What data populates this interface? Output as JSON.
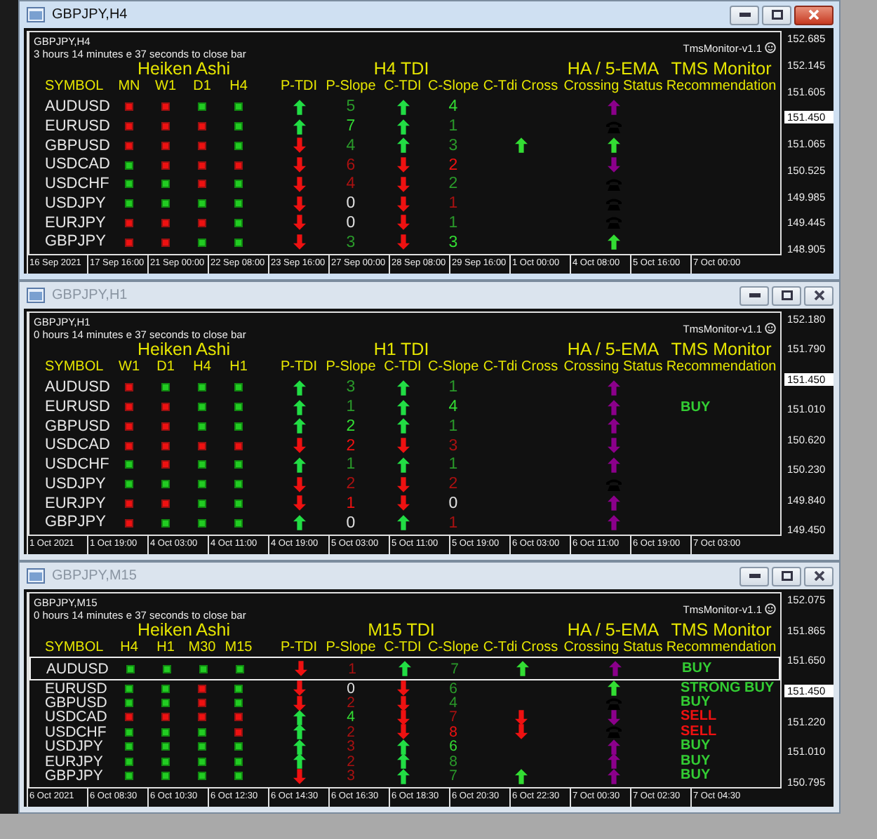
{
  "windows": [
    {
      "title": "GBPJPY,H4",
      "active": true,
      "chart_symbol": "GBPJPY,H4",
      "countdown": "3 hours 14 minutes e 37 seconds to close bar",
      "indicator": "TmsMonitor-v1.1",
      "groups": {
        "heiken": "Heiken Ashi",
        "tdi": "H4 TDI",
        "ema": "HA / 5-EMA",
        "tms": "TMS Monitor"
      },
      "columns": [
        "SYMBOL",
        "MN",
        "W1",
        "D1",
        "H4",
        "P-TDI",
        "P-Slope",
        "C-TDI",
        "C-Slope",
        "C-Tdi Cross",
        "Crossing Status",
        "Recommendation"
      ],
      "rows": [
        {
          "symbol": "AUDUSD",
          "selected": false,
          "ha": [
            {
              "bullish": false
            },
            {
              "bullish": false
            },
            {
              "bullish": true
            },
            {
              "bullish": true
            }
          ],
          "p_tdi": {
            "up": true
          },
          "p_slope": {
            "text": "5",
            "color": "#2a9a2a"
          },
          "c_tdi": {
            "up": true
          },
          "c_slope": {
            "text": "4",
            "color": "#33dd33"
          },
          "status": {
            "kind": "arrow",
            "up": true,
            "color": "#8b008b"
          }
        },
        {
          "symbol": "EURUSD",
          "selected": false,
          "ha": [
            {
              "bullish": false
            },
            {
              "bullish": false
            },
            {
              "bullish": false
            },
            {
              "bullish": true
            }
          ],
          "p_tdi": {
            "up": true
          },
          "p_slope": {
            "text": "7",
            "color": "#33dd33"
          },
          "c_tdi": {
            "up": true
          },
          "c_slope": {
            "text": "1",
            "color": "#2a9a2a"
          },
          "status": {
            "kind": "phone"
          }
        },
        {
          "symbol": "GBPUSD",
          "selected": false,
          "ha": [
            {
              "bullish": false
            },
            {
              "bullish": false
            },
            {
              "bullish": false
            },
            {
              "bullish": true
            }
          ],
          "p_tdi": {
            "up": false
          },
          "p_slope": {
            "text": "4",
            "color": "#2a9a2a"
          },
          "c_tdi": {
            "up": true
          },
          "c_slope": {
            "text": "3",
            "color": "#2a9a2a"
          },
          "cross": {
            "up": true,
            "color": "#33dd33"
          },
          "status": {
            "kind": "arrow",
            "up": true,
            "color": "#33dd33"
          }
        },
        {
          "symbol": "USDCAD",
          "selected": false,
          "ha": [
            {
              "bullish": true
            },
            {
              "bullish": false
            },
            {
              "bullish": false
            },
            {
              "bullish": false
            }
          ],
          "p_tdi": {
            "up": false
          },
          "p_slope": {
            "text": "6",
            "color": "#aa1111"
          },
          "c_tdi": {
            "up": false
          },
          "c_slope": {
            "text": "2",
            "color": "#ee1111"
          },
          "status": {
            "kind": "arrow",
            "up": false,
            "color": "#8b008b"
          }
        },
        {
          "symbol": "USDCHF",
          "selected": false,
          "ha": [
            {
              "bullish": true
            },
            {
              "bullish": true
            },
            {
              "bullish": false
            },
            {
              "bullish": true
            }
          ],
          "p_tdi": {
            "up": false
          },
          "p_slope": {
            "text": "4",
            "color": "#aa1111"
          },
          "c_tdi": {
            "up": false
          },
          "c_slope": {
            "text": "2",
            "color": "#2a9a2a"
          },
          "status": {
            "kind": "phone"
          }
        },
        {
          "symbol": "USDJPY",
          "selected": false,
          "ha": [
            {
              "bullish": true
            },
            {
              "bullish": true
            },
            {
              "bullish": true
            },
            {
              "bullish": true
            }
          ],
          "p_tdi": {
            "up": false
          },
          "p_slope": {
            "text": "0",
            "color": "#e0e0e0"
          },
          "c_tdi": {
            "up": false
          },
          "c_slope": {
            "text": "1",
            "color": "#aa1111"
          },
          "status": {
            "kind": "phone"
          }
        },
        {
          "symbol": "EURJPY",
          "selected": false,
          "ha": [
            {
              "bullish": false
            },
            {
              "bullish": false
            },
            {
              "bullish": false
            },
            {
              "bullish": true
            }
          ],
          "p_tdi": {
            "up": false
          },
          "p_slope": {
            "text": "0",
            "color": "#e0e0e0"
          },
          "c_tdi": {
            "up": false
          },
          "c_slope": {
            "text": "1",
            "color": "#2a9a2a"
          },
          "status": {
            "kind": "phone"
          }
        },
        {
          "symbol": "GBPJPY",
          "selected": false,
          "ha": [
            {
              "bullish": false
            },
            {
              "bullish": false
            },
            {
              "bullish": true
            },
            {
              "bullish": true
            }
          ],
          "p_tdi": {
            "up": false
          },
          "p_slope": {
            "text": "3",
            "color": "#2a9a2a"
          },
          "c_tdi": {
            "up": false
          },
          "c_slope": {
            "text": "3",
            "color": "#33dd33"
          },
          "status": {
            "kind": "arrow",
            "up": true,
            "color": "#33dd33"
          }
        }
      ],
      "time_axis": [
        "16 Sep 2021",
        "17 Sep 16:00",
        "21 Sep 00:00",
        "22 Sep 08:00",
        "23 Sep 16:00",
        "27 Sep 00:00",
        "28 Sep 08:00",
        "29 Sep 16:00",
        "1 Oct 00:00",
        "4 Oct 08:00",
        "5 Oct 16:00",
        "7 Oct 00:00"
      ],
      "price_axis": [
        {
          "text": "152.685",
          "current": false
        },
        {
          "text": "152.145",
          "current": false
        },
        {
          "text": "151.605",
          "current": false
        },
        {
          "text": "151.450",
          "current": true
        },
        {
          "text": "151.065",
          "current": false
        },
        {
          "text": "150.525",
          "current": false
        },
        {
          "text": "149.985",
          "current": false
        },
        {
          "text": "149.445",
          "current": false
        },
        {
          "text": "148.905",
          "current": false
        }
      ]
    },
    {
      "title": "GBPJPY,H1",
      "active": false,
      "chart_symbol": "GBPJPY,H1",
      "countdown": "0 hours 14 minutes e 37 seconds to close bar",
      "indicator": "TmsMonitor-v1.1",
      "groups": {
        "heiken": "Heiken Ashi",
        "tdi": "H1 TDI",
        "ema": "HA / 5-EMA",
        "tms": "TMS Monitor"
      },
      "columns": [
        "SYMBOL",
        "W1",
        "D1",
        "H4",
        "H1",
        "P-TDI",
        "P-Slope",
        "C-TDI",
        "C-Slope",
        "C-Tdi Cross",
        "Crossing Status",
        "Recommendation"
      ],
      "rows": [
        {
          "symbol": "AUDUSD",
          "selected": false,
          "ha": [
            {
              "bullish": false
            },
            {
              "bullish": true
            },
            {
              "bullish": true
            },
            {
              "bullish": true
            }
          ],
          "p_tdi": {
            "up": true
          },
          "p_slope": {
            "text": "3",
            "color": "#2a9a2a"
          },
          "c_tdi": {
            "up": true
          },
          "c_slope": {
            "text": "1",
            "color": "#2a9a2a"
          },
          "status": {
            "kind": "arrow",
            "up": true,
            "color": "#8b008b"
          }
        },
        {
          "symbol": "EURUSD",
          "selected": false,
          "ha": [
            {
              "bullish": false
            },
            {
              "bullish": false
            },
            {
              "bullish": true
            },
            {
              "bullish": true
            }
          ],
          "p_tdi": {
            "up": true
          },
          "p_slope": {
            "text": "1",
            "color": "#2a9a2a"
          },
          "c_tdi": {
            "up": true
          },
          "c_slope": {
            "text": "4",
            "color": "#33dd33"
          },
          "status": {
            "kind": "arrow",
            "up": true,
            "color": "#8b008b"
          },
          "recommendation": {
            "text": "BUY",
            "color": "#33cc33"
          }
        },
        {
          "symbol": "GBPUSD",
          "selected": false,
          "ha": [
            {
              "bullish": false
            },
            {
              "bullish": false
            },
            {
              "bullish": true
            },
            {
              "bullish": true
            }
          ],
          "p_tdi": {
            "up": true
          },
          "p_slope": {
            "text": "2",
            "color": "#33dd33"
          },
          "c_tdi": {
            "up": true
          },
          "c_slope": {
            "text": "1",
            "color": "#2a9a2a"
          },
          "status": {
            "kind": "arrow",
            "up": true,
            "color": "#8b008b"
          }
        },
        {
          "symbol": "USDCAD",
          "selected": false,
          "ha": [
            {
              "bullish": false
            },
            {
              "bullish": false
            },
            {
              "bullish": false
            },
            {
              "bullish": false
            }
          ],
          "p_tdi": {
            "up": false
          },
          "p_slope": {
            "text": "2",
            "color": "#ee1111"
          },
          "c_tdi": {
            "up": false
          },
          "c_slope": {
            "text": "3",
            "color": "#aa1111"
          },
          "status": {
            "kind": "arrow",
            "up": false,
            "color": "#8b008b"
          }
        },
        {
          "symbol": "USDCHF",
          "selected": false,
          "ha": [
            {
              "bullish": true
            },
            {
              "bullish": false
            },
            {
              "bullish": true
            },
            {
              "bullish": true
            }
          ],
          "p_tdi": {
            "up": true
          },
          "p_slope": {
            "text": "1",
            "color": "#2a9a2a"
          },
          "c_tdi": {
            "up": true
          },
          "c_slope": {
            "text": "1",
            "color": "#2a9a2a"
          },
          "status": {
            "kind": "arrow",
            "up": true,
            "color": "#8b008b"
          }
        },
        {
          "symbol": "USDJPY",
          "selected": false,
          "ha": [
            {
              "bullish": true
            },
            {
              "bullish": true
            },
            {
              "bullish": true
            },
            {
              "bullish": true
            }
          ],
          "p_tdi": {
            "up": false
          },
          "p_slope": {
            "text": "2",
            "color": "#aa1111"
          },
          "c_tdi": {
            "up": false
          },
          "c_slope": {
            "text": "2",
            "color": "#aa1111"
          },
          "status": {
            "kind": "phone"
          }
        },
        {
          "symbol": "EURJPY",
          "selected": false,
          "ha": [
            {
              "bullish": false
            },
            {
              "bullish": false
            },
            {
              "bullish": true
            },
            {
              "bullish": true
            }
          ],
          "p_tdi": {
            "up": false
          },
          "p_slope": {
            "text": "1",
            "color": "#ee1111"
          },
          "c_tdi": {
            "up": false
          },
          "c_slope": {
            "text": "0",
            "color": "#e0e0e0"
          },
          "status": {
            "kind": "arrow",
            "up": true,
            "color": "#8b008b"
          }
        },
        {
          "symbol": "GBPJPY",
          "selected": false,
          "ha": [
            {
              "bullish": false
            },
            {
              "bullish": true
            },
            {
              "bullish": true
            },
            {
              "bullish": true
            }
          ],
          "p_tdi": {
            "up": true
          },
          "p_slope": {
            "text": "0",
            "color": "#e0e0e0"
          },
          "c_tdi": {
            "up": true
          },
          "c_slope": {
            "text": "1",
            "color": "#aa1111"
          },
          "status": {
            "kind": "arrow",
            "up": true,
            "color": "#8b008b"
          }
        }
      ],
      "time_axis": [
        "1 Oct 2021",
        "1 Oct 19:00",
        "4 Oct 03:00",
        "4 Oct 11:00",
        "4 Oct 19:00",
        "5 Oct 03:00",
        "5 Oct 11:00",
        "5 Oct 19:00",
        "6 Oct 03:00",
        "6 Oct 11:00",
        "6 Oct 19:00",
        "7 Oct 03:00"
      ],
      "price_axis": [
        {
          "text": "152.180",
          "current": false
        },
        {
          "text": "151.790",
          "current": false
        },
        {
          "text": "151.450",
          "current": true
        },
        {
          "text": "151.010",
          "current": false
        },
        {
          "text": "150.620",
          "current": false
        },
        {
          "text": "150.230",
          "current": false
        },
        {
          "text": "149.840",
          "current": false
        },
        {
          "text": "149.450",
          "current": false
        }
      ]
    },
    {
      "title": "GBPJPY,M15",
      "active": false,
      "chart_symbol": "GBPJPY,M15",
      "countdown": "0 hours 14 minutes e 37 seconds to close bar",
      "indicator": "TmsMonitor-v1.1",
      "groups": {
        "heiken": "Heiken Ashi",
        "tdi": "M15 TDI",
        "ema": "HA / 5-EMA",
        "tms": "TMS Monitor"
      },
      "columns": [
        "SYMBOL",
        "H4",
        "H1",
        "M30",
        "M15",
        "P-TDI",
        "P-Slope",
        "C-TDI",
        "C-Slope",
        "C-Tdi Cross",
        "Crossing Status",
        "Recommendation"
      ],
      "rows": [
        {
          "symbol": "AUDUSD",
          "selected": true,
          "ha": [
            {
              "bullish": true
            },
            {
              "bullish": true
            },
            {
              "bullish": true
            },
            {
              "bullish": true
            }
          ],
          "p_tdi": {
            "up": false
          },
          "p_slope": {
            "text": "1",
            "color": "#aa1111"
          },
          "c_tdi": {
            "up": true
          },
          "c_slope": {
            "text": "7",
            "color": "#2a9a2a"
          },
          "cross": {
            "up": true,
            "color": "#33dd33"
          },
          "status": {
            "kind": "arrow",
            "up": true,
            "color": "#8b008b"
          },
          "recommendation": {
            "text": "BUY",
            "color": "#33cc33"
          }
        },
        {
          "symbol": "EURUSD",
          "selected": false,
          "ha": [
            {
              "bullish": true
            },
            {
              "bullish": true
            },
            {
              "bullish": false
            },
            {
              "bullish": true
            }
          ],
          "p_tdi": {
            "up": false
          },
          "p_slope": {
            "text": "0",
            "color": "#e0e0e0"
          },
          "c_tdi": {
            "up": false
          },
          "c_slope": {
            "text": "6",
            "color": "#2a9a2a"
          },
          "status": {
            "kind": "arrow",
            "up": true,
            "color": "#33dd33"
          },
          "recommendation": {
            "text": "STRONG BUY",
            "color": "#33cc33"
          }
        },
        {
          "symbol": "GBPUSD",
          "selected": false,
          "ha": [
            {
              "bullish": true
            },
            {
              "bullish": true
            },
            {
              "bullish": false
            },
            {
              "bullish": true
            }
          ],
          "p_tdi": {
            "up": false
          },
          "p_slope": {
            "text": "2",
            "color": "#aa1111"
          },
          "c_tdi": {
            "up": false
          },
          "c_slope": {
            "text": "4",
            "color": "#2a9a2a"
          },
          "status": {
            "kind": "phone"
          },
          "recommendation": {
            "text": "BUY",
            "color": "#33cc33"
          }
        },
        {
          "symbol": "USDCAD",
          "selected": false,
          "ha": [
            {
              "bullish": false
            },
            {
              "bullish": false
            },
            {
              "bullish": false
            },
            {
              "bullish": false
            }
          ],
          "p_tdi": {
            "up": true
          },
          "p_slope": {
            "text": "4",
            "color": "#33dd33"
          },
          "c_tdi": {
            "up": false
          },
          "c_slope": {
            "text": "7",
            "color": "#aa1111"
          },
          "cross": {
            "up": false,
            "color": "#ee1111"
          },
          "status": {
            "kind": "arrow",
            "up": false,
            "color": "#8b008b"
          },
          "recommendation": {
            "text": "SELL",
            "color": "#ee1111"
          }
        },
        {
          "symbol": "USDCHF",
          "selected": false,
          "ha": [
            {
              "bullish": true
            },
            {
              "bullish": true
            },
            {
              "bullish": true
            },
            {
              "bullish": false
            }
          ],
          "p_tdi": {
            "up": true
          },
          "p_slope": {
            "text": "2",
            "color": "#aa1111"
          },
          "c_tdi": {
            "up": false
          },
          "c_slope": {
            "text": "8",
            "color": "#ee1111"
          },
          "cross": {
            "up": false,
            "color": "#ee1111"
          },
          "status": {
            "kind": "phone"
          },
          "recommendation": {
            "text": "SELL",
            "color": "#ee1111"
          }
        },
        {
          "symbol": "USDJPY",
          "selected": false,
          "ha": [
            {
              "bullish": true
            },
            {
              "bullish": true
            },
            {
              "bullish": true
            },
            {
              "bullish": true
            }
          ],
          "p_tdi": {
            "up": true
          },
          "p_slope": {
            "text": "3",
            "color": "#aa1111"
          },
          "c_tdi": {
            "up": true
          },
          "c_slope": {
            "text": "6",
            "color": "#33dd33"
          },
          "status": {
            "kind": "arrow",
            "up": true,
            "color": "#8b008b"
          },
          "recommendation": {
            "text": "BUY",
            "color": "#33cc33"
          }
        },
        {
          "symbol": "EURJPY",
          "selected": false,
          "ha": [
            {
              "bullish": true
            },
            {
              "bullish": true
            },
            {
              "bullish": true
            },
            {
              "bullish": true
            }
          ],
          "p_tdi": {
            "up": true
          },
          "p_slope": {
            "text": "2",
            "color": "#aa1111"
          },
          "c_tdi": {
            "up": true
          },
          "c_slope": {
            "text": "8",
            "color": "#2a9a2a"
          },
          "status": {
            "kind": "arrow",
            "up": true,
            "color": "#8b008b"
          },
          "recommendation": {
            "text": "BUY",
            "color": "#33cc33"
          }
        },
        {
          "symbol": "GBPJPY",
          "selected": false,
          "ha": [
            {
              "bullish": true
            },
            {
              "bullish": true
            },
            {
              "bullish": true
            },
            {
              "bullish": true
            }
          ],
          "p_tdi": {
            "up": false
          },
          "p_slope": {
            "text": "3",
            "color": "#aa1111"
          },
          "c_tdi": {
            "up": true
          },
          "c_slope": {
            "text": "7",
            "color": "#2a9a2a"
          },
          "cross": {
            "up": true,
            "color": "#33dd33"
          },
          "status": {
            "kind": "arrow",
            "up": true,
            "color": "#8b008b"
          },
          "recommendation": {
            "text": "BUY",
            "color": "#33cc33"
          }
        }
      ],
      "time_axis": [
        "6 Oct 2021",
        "6 Oct 08:30",
        "6 Oct 10:30",
        "6 Oct 12:30",
        "6 Oct 14:30",
        "6 Oct 16:30",
        "6 Oct 18:30",
        "6 Oct 20:30",
        "6 Oct 22:30",
        "7 Oct 00:30",
        "7 Oct 02:30",
        "7 Oct 04:30"
      ],
      "price_axis": [
        {
          "text": "152.075",
          "current": false
        },
        {
          "text": "151.865",
          "current": false
        },
        {
          "text": "151.650",
          "current": false
        },
        {
          "text": "151.450",
          "current": true
        },
        {
          "text": "151.220",
          "current": false
        },
        {
          "text": "151.010",
          "current": false
        },
        {
          "text": "150.795",
          "current": false
        }
      ]
    }
  ]
}
